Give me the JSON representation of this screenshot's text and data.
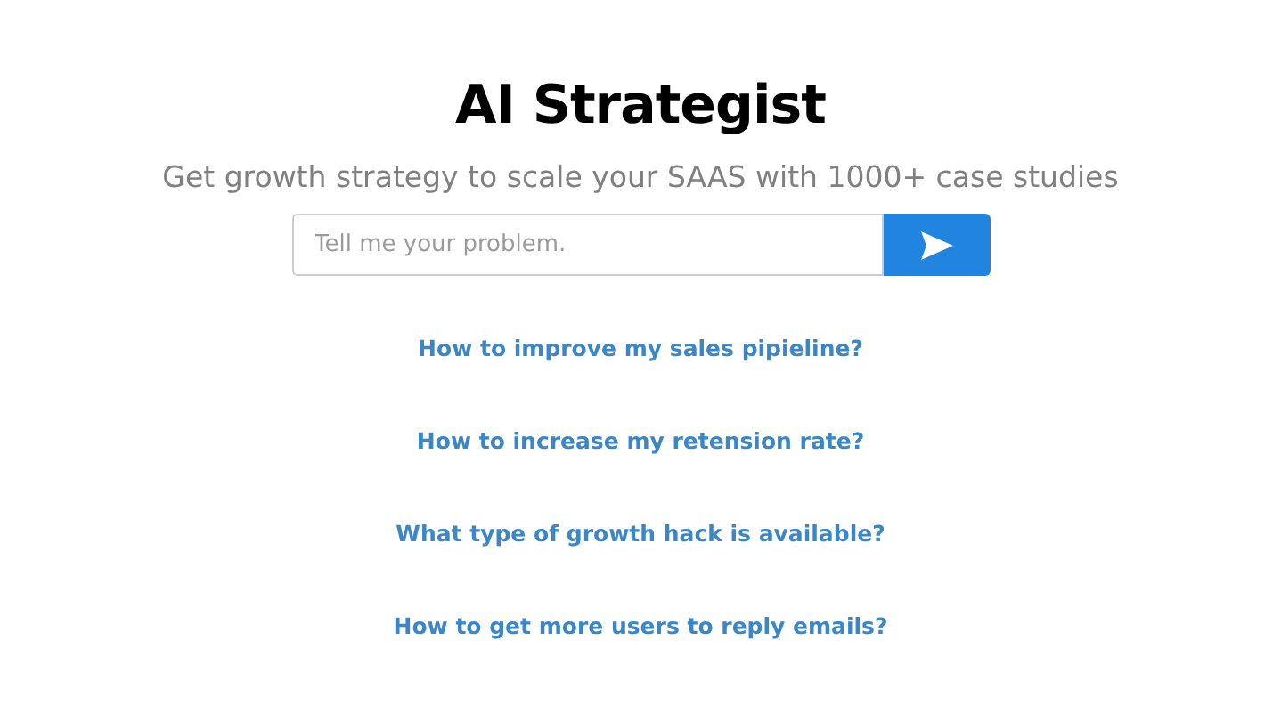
{
  "title": "AI Strategist",
  "subtitle": "Get growth strategy to scale your SAAS with 1000+ case studies",
  "search": {
    "placeholder": "Tell me your problem."
  },
  "suggestions": [
    "How to improve my sales pipieline?",
    "How to increase my retension rate?",
    "What type of growth hack is available?",
    "How to get more users to reply emails?"
  ]
}
